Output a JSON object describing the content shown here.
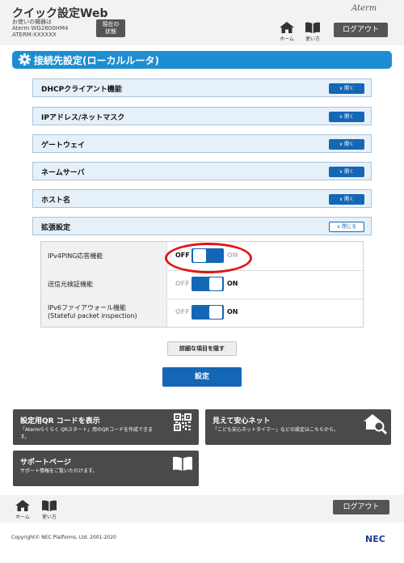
{
  "header": {
    "app_title": "クイック設定Web",
    "device_label": "お使いの機器は",
    "device_model": "Aterm WG2600HM4",
    "device_name": "ATERM-XXXXXX",
    "status_button": "現在の\n状態",
    "brand": "Aterm",
    "home_label": "ホーム",
    "howto_label": "使い方",
    "logout_label": "ログアウト"
  },
  "section": {
    "title": "接続先設定(ローカルルータ)",
    "icon": "gear-icon"
  },
  "accordion": [
    {
      "label": "DHCPクライアント機能",
      "button": "開く",
      "state": "collapsed"
    },
    {
      "label": "IPアドレス/ネットマスク",
      "button": "開く",
      "state": "collapsed"
    },
    {
      "label": "ゲートウェイ",
      "button": "開く",
      "state": "collapsed"
    },
    {
      "label": "ネームサーバ",
      "button": "開く",
      "state": "collapsed"
    },
    {
      "label": "ホスト名",
      "button": "開く",
      "state": "collapsed"
    },
    {
      "label": "拡張設定",
      "button": "閉じる",
      "state": "expanded"
    }
  ],
  "settings": [
    {
      "label_line1": "IPv4PING応答機能",
      "label_line2": "",
      "state": "OFF",
      "off_label": "OFF",
      "on_label": "ON"
    },
    {
      "label_line1": "送信元検証機能",
      "label_line2": "",
      "state": "ON",
      "off_label": "OFF",
      "on_label": "ON"
    },
    {
      "label_line1": "IPv6ファイアウォール機能",
      "label_line2": "(Stateful packet inspection)",
      "state": "ON",
      "off_label": "OFF",
      "on_label": "ON"
    }
  ],
  "buttons": {
    "detail": "詳細な項目を隠す",
    "apply": "設定"
  },
  "cards": [
    {
      "title": "設定用QR コードを表示",
      "desc1": "「Atermらくらく QRスタート」用のQRコードを作成できま",
      "desc2": "す。",
      "icon": "qr-code-icon"
    },
    {
      "title": "見えて安心ネット",
      "desc1": "「こども安心ネットタイマー」などの設定はこちらから。",
      "desc2": "",
      "icon": "home-search-icon"
    },
    {
      "title": "サポートページ",
      "desc1": "サポート情報をご覧いただけます。",
      "desc2": "",
      "icon": "book-icon"
    }
  ],
  "footer": {
    "home_label": "ホーム",
    "howto_label": "使い方",
    "logout_label": "ログアウト",
    "copyright": "Copyright© NEC Platforms, Ltd. 2001-2020",
    "nec_logo": "NEC"
  },
  "colors": {
    "primary": "#1567b5",
    "section": "#1e8ed0",
    "accordion_bg": "#e6f0f8",
    "card": "#4a4a4a",
    "highlight_ring": "#e01616"
  }
}
